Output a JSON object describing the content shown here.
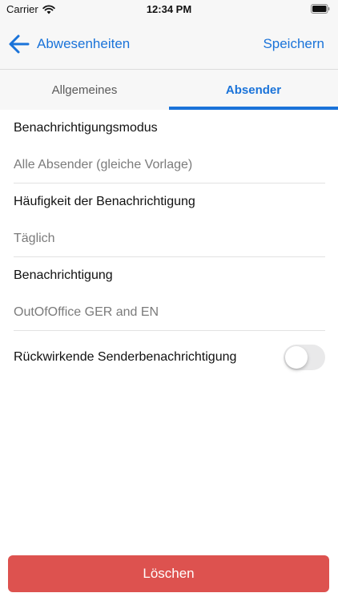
{
  "status_bar": {
    "carrier": "Carrier",
    "time": "12:34 PM",
    "icons": [
      "wifi-icon",
      "battery-icon"
    ]
  },
  "nav": {
    "back_label": "Abwesenheiten",
    "save_label": "Speichern",
    "back_icon": "arrow-left-icon"
  },
  "tabs": [
    {
      "label": "Allgemeines",
      "active": false
    },
    {
      "label": "Absender",
      "active": true
    }
  ],
  "settings": {
    "mode": {
      "title": "Benachrichtigungsmodus",
      "value": "Alle Absender (gleiche Vorlage)"
    },
    "frequency": {
      "title": "Häufigkeit der Benachrichtigung",
      "value": "Täglich"
    },
    "notification": {
      "title": "Benachrichtigung",
      "value": "OutOfOffice GER and EN"
    },
    "retroactive": {
      "label": "Rückwirkende Senderbenachrichtigung",
      "enabled": false
    }
  },
  "delete_label": "Löschen",
  "colors": {
    "accent": "#1a73d9",
    "danger": "#dd524f",
    "bar_background": "#f7f7f7",
    "secondary_text": "#7b7b7b"
  }
}
